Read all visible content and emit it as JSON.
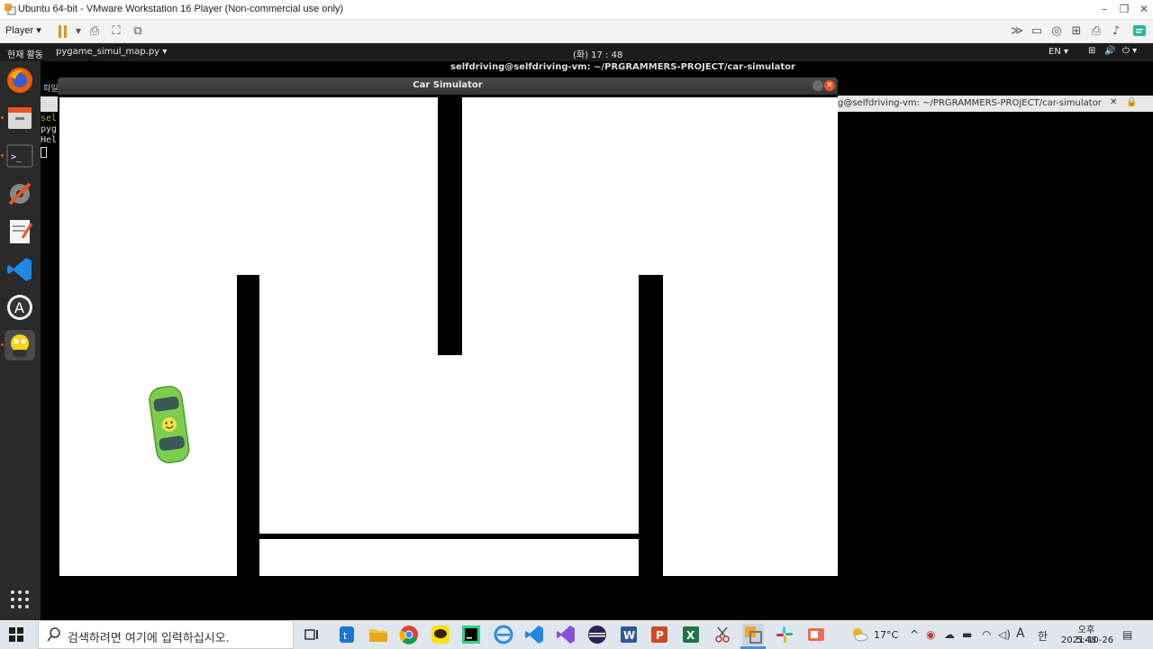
{
  "vmware": {
    "title": "Ubuntu 64-bit - VMware Workstation 16 Player (Non-commercial use only)",
    "player_menu": "Player ▾"
  },
  "gnome": {
    "activities": "현재 활동",
    "app_menu": "pygame_simul_map.py ▾",
    "clock": "(화) 17 : 48",
    "lang": "EN ▾"
  },
  "terminal": {
    "window_title": "selfdriving@selfdriving-vm: ~/PRGRAMMERS-PROJECT/car-simulator",
    "tab_title": "g@selfdriving-vm: ~/PRGRAMMERS-PROJECT/car-simulator",
    "side_label": "파일",
    "lines": [
      "sel",
      "pyg",
      "Hel"
    ]
  },
  "simulator": {
    "title": "Car Simulator",
    "close_glyph": "✕",
    "car_color": "#7ccd4e"
  },
  "taskbar": {
    "search_placeholder": "검색하려면 여기에 입력하십시오.",
    "temperature": "17°C",
    "ime_a": "A",
    "ime_han": "한",
    "time": "오후 5:48",
    "date": "2021-10-26"
  }
}
